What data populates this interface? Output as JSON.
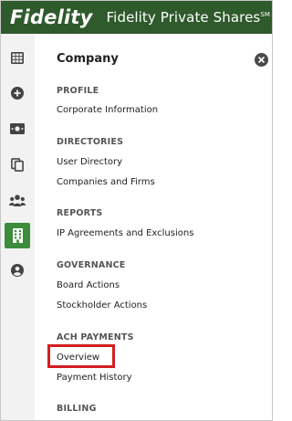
{
  "header": {
    "logo": "Fidelity",
    "product": "Fidelity Private Shares",
    "product_mark": "SM"
  },
  "rail": {
    "items": [
      {
        "icon": "grid-icon",
        "active": false
      },
      {
        "icon": "add-circle-icon",
        "active": false
      },
      {
        "icon": "money-icon",
        "active": false
      },
      {
        "icon": "copy-documents-icon",
        "active": false
      },
      {
        "icon": "people-group-icon",
        "active": false
      },
      {
        "icon": "building-icon",
        "active": true
      },
      {
        "icon": "user-circle-icon",
        "active": false
      }
    ]
  },
  "panel": {
    "title": "Company",
    "sections": [
      {
        "heading": "PROFILE",
        "links": [
          "Corporate Information"
        ]
      },
      {
        "heading": "DIRECTORIES",
        "links": [
          "User Directory",
          "Companies and Firms"
        ]
      },
      {
        "heading": "REPORTS",
        "links": [
          "IP Agreements and Exclusions"
        ]
      },
      {
        "heading": "GOVERNANCE",
        "links": [
          "Board Actions",
          "Stockholder Actions"
        ]
      },
      {
        "heading": "ACH PAYMENTS",
        "links": [
          "Overview",
          "Payment History"
        ]
      },
      {
        "heading": "BILLING",
        "links": []
      }
    ]
  },
  "colors": {
    "header_bg": "#2f5a2c",
    "active_rail": "#3c8c3c",
    "highlight": "#d21f1f"
  }
}
